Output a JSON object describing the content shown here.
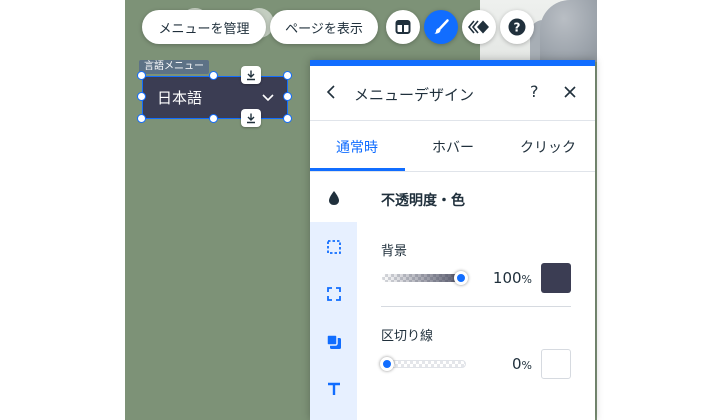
{
  "toolbar": {
    "manage_menu_label": "メニューを管理",
    "show_pages_label": "ページを表示",
    "icons": [
      "layout-icon",
      "design-brush-icon",
      "animation-icon",
      "help-icon"
    ]
  },
  "element": {
    "type_label": "言語メニュー",
    "selected_language": "日本語"
  },
  "panel": {
    "title": "メニューデザイン",
    "help_label": "?",
    "tabs": [
      {
        "label": "通常時",
        "active": true
      },
      {
        "label": "ホバー",
        "active": false
      },
      {
        "label": "クリック",
        "active": false
      }
    ],
    "section_title": "不透明度・色",
    "sidebar_icons": [
      "fill-opacity-icon",
      "border-icon",
      "corners-icon",
      "shadow-icon",
      "text-icon"
    ],
    "background": {
      "label": "背景",
      "opacity_value": "100",
      "unit": "%",
      "opacity_fraction": 1.0,
      "color": "#3b3d53"
    },
    "border": {
      "label": "区切り線",
      "opacity_value": "0",
      "unit": "%",
      "opacity_fraction": 0.0,
      "color": "#ffffff"
    }
  },
  "colors": {
    "accent": "#116dff",
    "canvas_bg": "#7d9277",
    "menu_bg": "#3b3d53"
  }
}
